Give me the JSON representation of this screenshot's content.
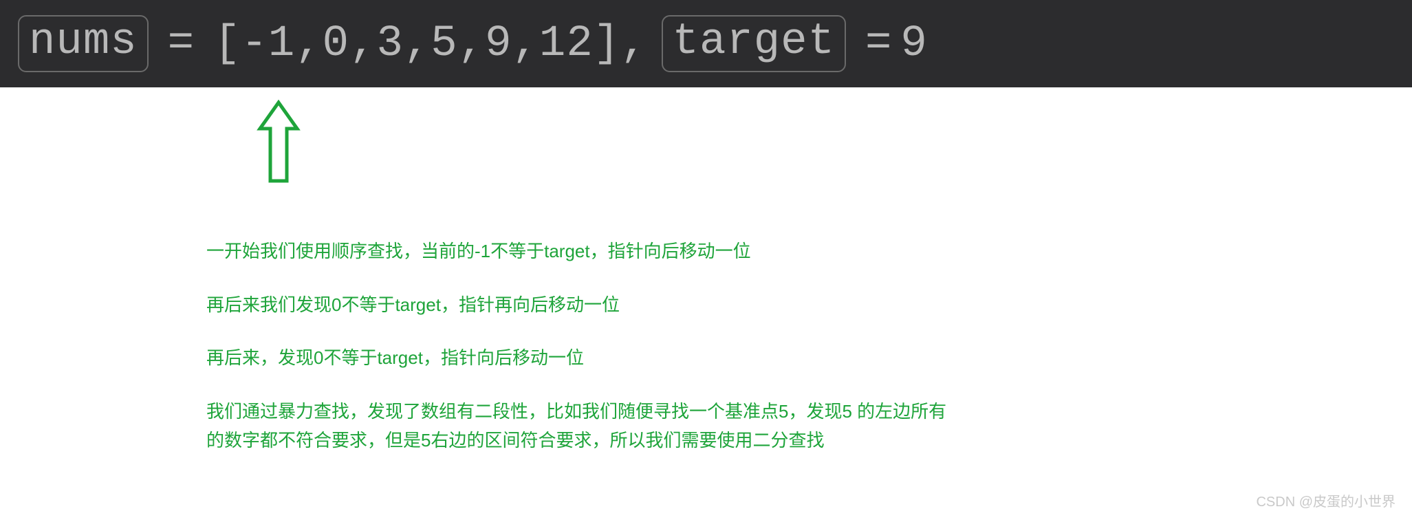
{
  "code": {
    "var1": "nums",
    "eq1": " = ",
    "array": "[-1,0,3,5,9,12]",
    "comma": ", ",
    "var2": "target",
    "eq2": " = ",
    "value": "9"
  },
  "explain": {
    "line1": "一开始我们使用顺序查找，当前的-1不等于target，指针向后移动一位",
    "line2": "再后来我们发现0不等于target，指针再向后移动一位",
    "line3": "再后来，发现0不等于target，指针向后移动一位",
    "line4": "我们通过暴力查找，发现了数组有二段性，比如我们随便寻找一个基准点5，发现5 的左边所有的数字都不符合要求，但是5右边的区间符合要求，所以我们需要使用二分查找"
  },
  "watermark": "CSDN @皮蛋的小世界",
  "colors": {
    "explain_green": "#1ea43a",
    "arrow_green": "#1ea43a",
    "code_bg": "#2c2c2e",
    "code_fg": "#b8b8b8"
  }
}
